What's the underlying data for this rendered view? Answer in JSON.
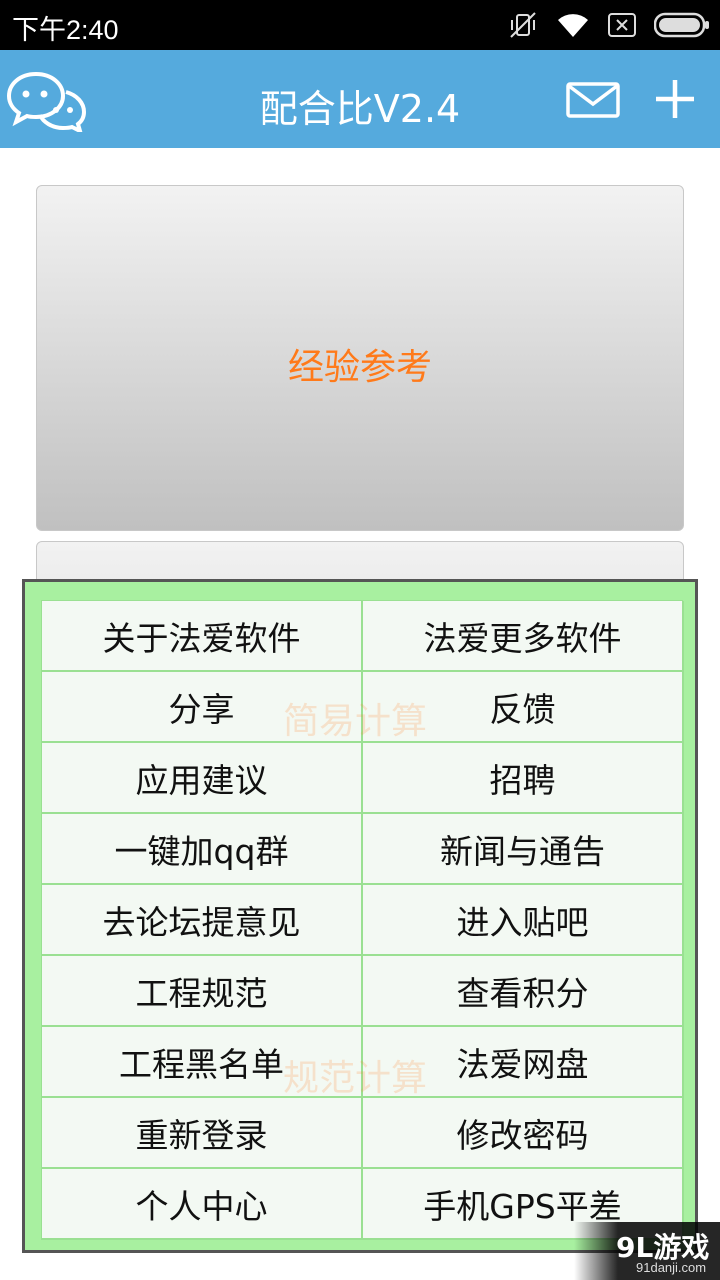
{
  "status_bar": {
    "time": "下午2:40",
    "icons": [
      "vibrate-off-icon",
      "wifi-icon",
      "sim-off-icon",
      "battery-icon"
    ]
  },
  "app_bar": {
    "title": "配合比V2.4",
    "left_icon": "chat-bubbles-icon",
    "right_icons": [
      "mail-icon",
      "plus-icon"
    ],
    "background": "#55aadd"
  },
  "panels": {
    "experience": "经验参考",
    "simple_calc": "简易计算",
    "spec_calc": "规范计算"
  },
  "menu": {
    "items": [
      "关于法爱软件",
      "法爱更多软件",
      "分享",
      "反馈",
      "应用建议",
      "招聘",
      "一键加qq群",
      "新闻与通告",
      "去论坛提意见",
      "进入贴吧",
      "工程规范",
      "查看积分",
      "工程黑名单",
      "法爱网盘",
      "重新登录",
      "修改密码",
      "个人中心",
      "手机GPS平差"
    ],
    "border_color": "#a8f0a0"
  },
  "watermark": {
    "main": "9L游戏",
    "sub": "91danji.com"
  },
  "accent_color": "#ff7a1a"
}
